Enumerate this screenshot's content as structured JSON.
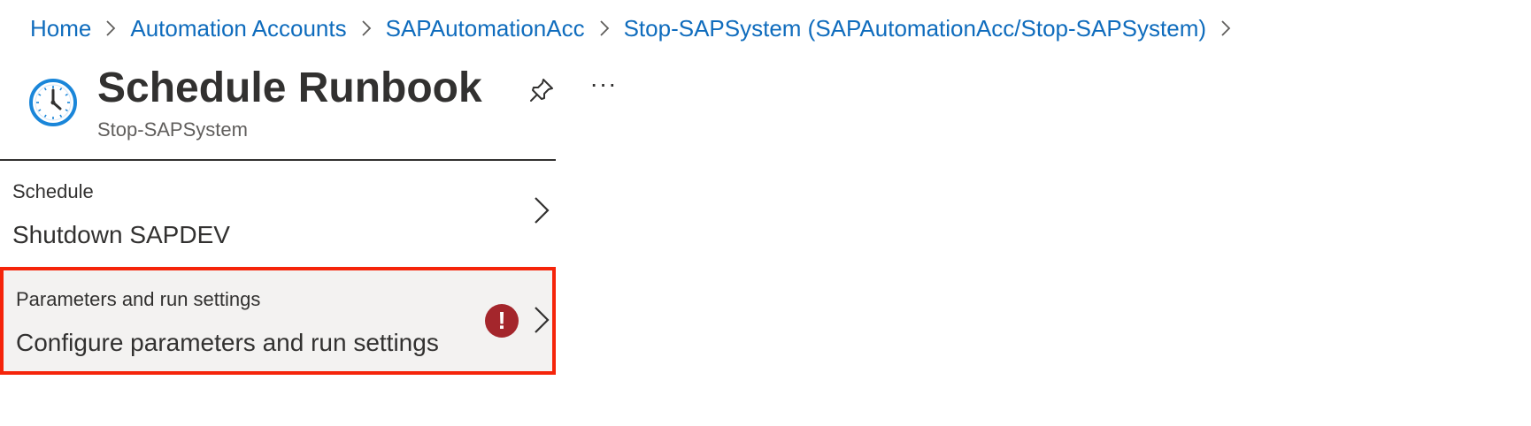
{
  "breadcrumb": {
    "items": [
      {
        "label": "Home"
      },
      {
        "label": "Automation Accounts"
      },
      {
        "label": "SAPAutomationAcc"
      },
      {
        "label": "Stop-SAPSystem (SAPAutomationAcc/Stop-SAPSystem)"
      }
    ],
    "separator_icon": "chevron-right-icon"
  },
  "header": {
    "title": "Schedule Runbook",
    "subtitle": "Stop-SAPSystem",
    "icon": "clock-icon",
    "pin_icon": "pin-icon",
    "more_label": "···"
  },
  "items": {
    "schedule": {
      "label": "Schedule",
      "value": "Shutdown SAPDEV",
      "icon": "chevron-right-icon"
    },
    "parameters": {
      "label": "Parameters and run settings",
      "value": "Configure parameters and run settings",
      "status_icon": "error-icon",
      "status_glyph": "!",
      "icon": "chevron-right-icon"
    }
  },
  "colors": {
    "link": "#0f6cbd",
    "text": "#323130",
    "subtext": "#605e5c",
    "highlight_border": "#f5240a",
    "error": "#a4262c",
    "selected_bg": "#f3f2f1",
    "clock_accent": "#1a86d9"
  }
}
